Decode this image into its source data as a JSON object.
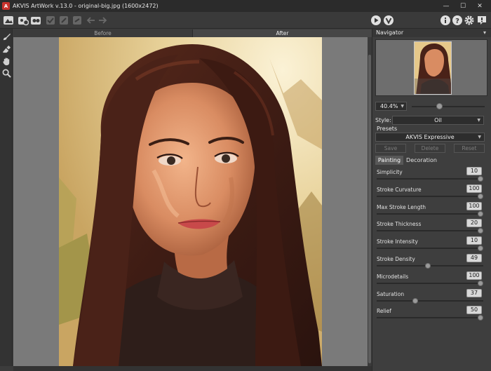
{
  "window": {
    "title": "AKVIS ArtWork v.13.0 - original-big.jpg (1600x2472)",
    "logo_letter": "A",
    "controls": {
      "minimize": "—",
      "maximize": "☐",
      "close": "✕"
    }
  },
  "toolbar": {
    "icons": [
      "open-icon",
      "batch-icon",
      "plugin-icon",
      "save-icon",
      "print-icon",
      "share-icon",
      "undo-icon",
      "redo-icon",
      "run-icon",
      "apply-icon",
      "info-icon",
      "help-icon",
      "settings-icon",
      "news-icon"
    ]
  },
  "left_tools": [
    "brush-icon",
    "eraser-icon",
    "hand-icon",
    "zoom-icon"
  ],
  "view_tabs": {
    "before": "Before",
    "after": "After"
  },
  "navigator": {
    "title": "Navigator",
    "zoom": "40.4%",
    "zoom_fraction": 0.4
  },
  "style": {
    "label": "Style:",
    "value": "Oil"
  },
  "presets": {
    "label": "Presets",
    "value": "AKVIS Expressive",
    "save": "Save",
    "delete": "Delete",
    "reset": "Reset"
  },
  "subtabs": {
    "painting": "Painting",
    "decoration": "Decoration"
  },
  "params": [
    {
      "label": "Simplicity",
      "value": "10",
      "level": 1.0
    },
    {
      "label": "Stroke Curvature",
      "value": "100",
      "level": 1.0
    },
    {
      "label": "Max Stroke Length",
      "value": "100",
      "level": 1.0
    },
    {
      "label": "Stroke Thickness",
      "value": "20",
      "level": 1.0
    },
    {
      "label": "Stroke Intensity",
      "value": "10",
      "level": 1.0
    },
    {
      "label": "Stroke Density",
      "value": "49",
      "level": 0.49
    },
    {
      "label": "Microdetails",
      "value": "100",
      "level": 1.0
    },
    {
      "label": "Saturation",
      "value": "37",
      "level": 0.37
    },
    {
      "label": "Relief",
      "value": "50",
      "level": 1.0
    }
  ]
}
